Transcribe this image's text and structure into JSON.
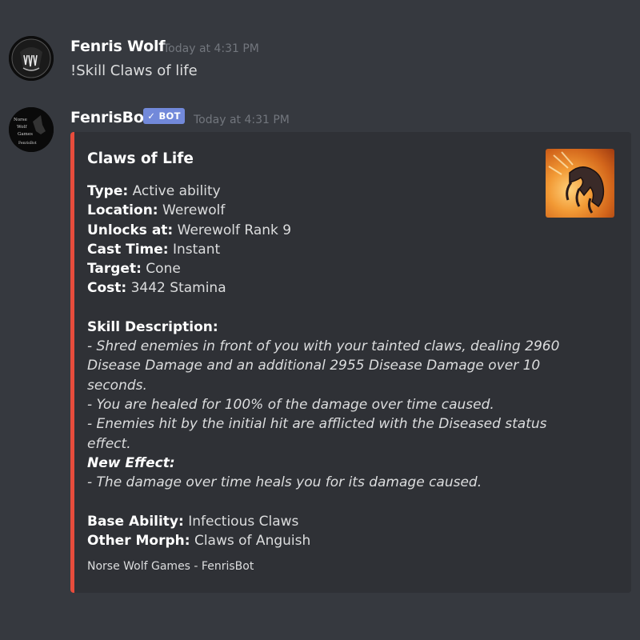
{
  "messages": [
    {
      "username": "Fenris Wolf",
      "timestamp": "Today at 4:31 PM",
      "content": "!Skill Claws of life"
    },
    {
      "username": "FenrisBot",
      "bot_tag": "✓ BOT",
      "timestamp": "Today at 4:31 PM",
      "avatar_text": [
        "Norse",
        "Wolf",
        "Games",
        "FenrisBot"
      ]
    }
  ],
  "embed": {
    "accent_color": "#e74c3c",
    "title": "Claws of Life",
    "fields": [
      {
        "label": "Type:",
        "value": "Active ability"
      },
      {
        "label": "Location:",
        "value": "Werewolf"
      },
      {
        "label": "Unlocks at:",
        "value": "Werewolf Rank 9"
      },
      {
        "label": "Cast Time:",
        "value": "Instant"
      },
      {
        "label": "Target:",
        "value": "Cone"
      },
      {
        "label": "Cost:",
        "value": "3442 Stamina"
      }
    ],
    "description_heading": "Skill Description:",
    "description_lines": [
      "- Shred enemies in front of you with your tainted claws, dealing 2960",
      "Disease Damage and an additional 2955 Disease Damage over 10",
      "seconds.",
      "- You are healed for 100% of the damage over time caused.",
      "- Enemies hit by the initial hit are afflicted with the Diseased status",
      "effect."
    ],
    "new_effect_heading": "New Effect:",
    "new_effect_line": "- The damage over time heals you for its damage caused.",
    "extra_fields": [
      {
        "label": "Base Ability:",
        "value": "Infectious Claws"
      },
      {
        "label": "Other Morph:",
        "value": "Claws of Anguish"
      }
    ],
    "footer": "Norse Wolf Games - FenrisBot",
    "thumbnail_icon": "claw-icon"
  }
}
